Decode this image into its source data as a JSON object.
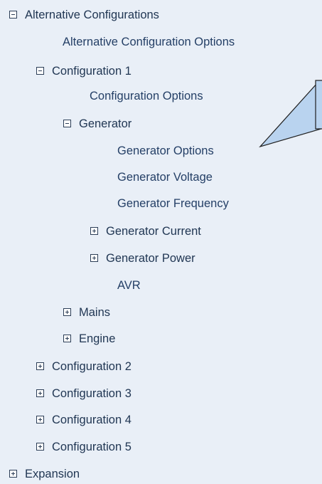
{
  "tree": {
    "root_1": {
      "label": "Alternative Configurations",
      "expanded": true,
      "children": {
        "options": {
          "label": "Alternative Configuration Options"
        },
        "configuration_1": {
          "label": "Configuration 1",
          "expanded": true,
          "children": {
            "options": {
              "label": "Configuration Options"
            },
            "generator": {
              "label": "Generator",
              "expanded": true,
              "children": {
                "options": {
                  "label": "Generator Options"
                },
                "voltage": {
                  "label": "Generator Voltage"
                },
                "frequency": {
                  "label": "Generator Frequency"
                },
                "current": {
                  "label": "Generator Current",
                  "expanded": false
                },
                "power": {
                  "label": "Generator Power",
                  "expanded": false
                },
                "avr": {
                  "label": "AVR"
                }
              }
            },
            "mains": {
              "label": "Mains",
              "expanded": false
            },
            "engine": {
              "label": "Engine",
              "expanded": false
            }
          }
        },
        "configuration_2": {
          "label": "Configuration 2",
          "expanded": false
        },
        "configuration_3": {
          "label": "Configuration 3",
          "expanded": false
        },
        "configuration_4": {
          "label": "Configuration 4",
          "expanded": false
        },
        "configuration_5": {
          "label": "Configuration 5",
          "expanded": false
        }
      }
    },
    "root_2": {
      "label": "Expansion",
      "expanded": false
    }
  },
  "colors": {
    "panel_background": "#e9eff7",
    "text": "#1f3552",
    "toggle_border": "#2c3e57",
    "callout_fill": "#b9d3ef",
    "callout_stroke": "#1f1f1f"
  },
  "icons": {
    "expanded": "minus-box-icon",
    "collapsed": "plus-box-icon"
  }
}
